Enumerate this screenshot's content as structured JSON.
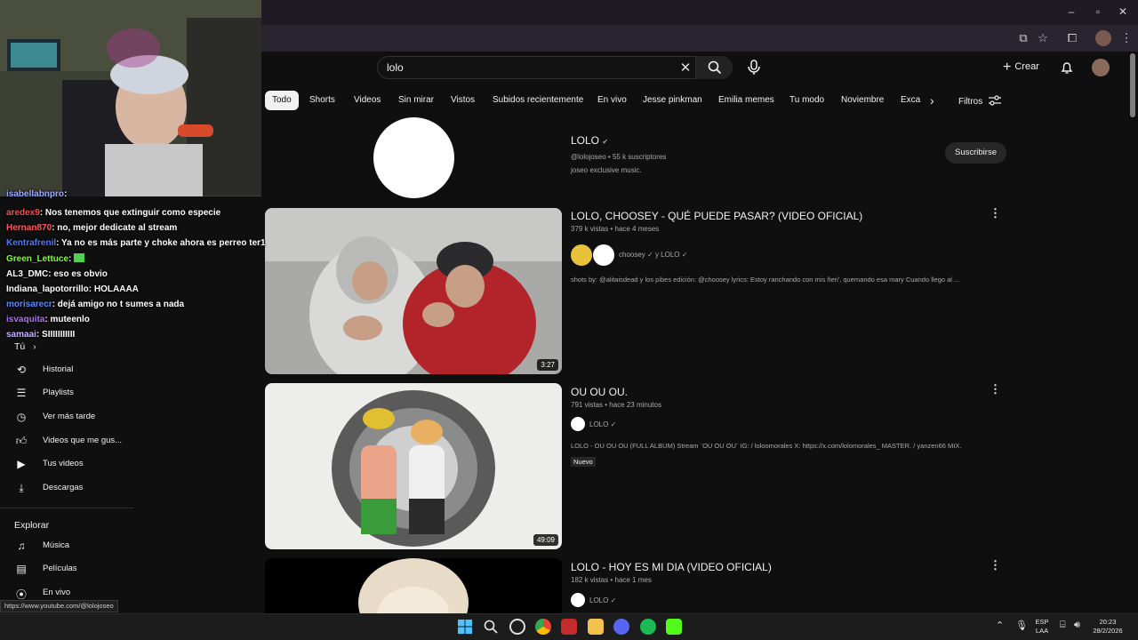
{
  "search": {
    "query": "lolo"
  },
  "header": {
    "create_label": "Crear"
  },
  "chips": [
    "Todo",
    "Shorts",
    "Videos",
    "Sin mirar",
    "Vistos",
    "Subidos recientemente",
    "En vivo",
    "Jesse pinkman",
    "Emilia memes",
    "Tu modo",
    "Noviembre",
    "Exca"
  ],
  "filters_label": "Filtros",
  "channel": {
    "name": "LOLO",
    "meta": "@lolojoseo • 55 k suscriptores",
    "description": "joseo exclusive music.",
    "subscribe_label": "Suscribirse"
  },
  "videos": [
    {
      "title": "LOLO, CHOOSEY - QUÉ PUEDE PASAR? (VIDEO OFICIAL)",
      "meta": "379 k vistas • hace 4 meses",
      "channel": "choosey ✓ y LOLO ✓",
      "description": "shots by: @alitaisdead y los pibes edición: @choosey lyrics: Estoy ranchando con mis ñeri', quemando esa mary Cuando llego al ...",
      "duration": "3:27"
    },
    {
      "title": "OU OU OU.",
      "meta": "791 vistas • hace 23 minutos",
      "channel": "LOLO ✓",
      "description": "LOLO - OU OU OU (FULL ALBUM) Stream ¨OU OU OU¨ IG: / loloomorales X: https://x.com/lolomorales_ MASTER. / yanzen66 MIX.",
      "badge": "Nuevo",
      "duration": "49:09"
    },
    {
      "title": "LOLO - HOY ES MI DIA (VIDEO OFICIAL)",
      "meta": "182 k vistas • hace 1 mes",
      "channel": "LOLO ✓"
    }
  ],
  "sidebar": {
    "you_label": "Tú",
    "you_items": [
      {
        "label": "Historial",
        "icon": "history-icon"
      },
      {
        "label": "Playlists",
        "icon": "playlists-icon"
      },
      {
        "label": "Ver más tarde",
        "icon": "watch-later-icon"
      },
      {
        "label": "Videos que me gus...",
        "icon": "like-icon"
      },
      {
        "label": "Tus videos",
        "icon": "your-videos-icon"
      },
      {
        "label": "Descargas",
        "icon": "download-icon"
      }
    ],
    "explore_label": "Explorar",
    "explore_items": [
      {
        "label": "Música",
        "icon": "music-icon"
      },
      {
        "label": "Películas",
        "icon": "movies-icon"
      },
      {
        "label": "En vivo",
        "icon": "live-icon"
      }
    ]
  },
  "chat": [
    {
      "user": "isabellabnpro",
      "text": ":",
      "color": "#9fa8ff"
    },
    {
      "user": "aredex9",
      "text": ": Nos tenemos que extinguir como especie",
      "color": "#ff4b4b"
    },
    {
      "user": "Hernan870",
      "text": ": no, mejor dedicate al stream",
      "color": "#ff5a5a"
    },
    {
      "user": "Kentrafrenil",
      "text": ": Ya no es más parte y choke ahora es perreo ter1",
      "color": "#4b7bff"
    },
    {
      "user": "Green_Lettuce",
      "text": ":",
      "color": "#7dff3a"
    },
    {
      "user": "AL3_DMC",
      "text": ": eso es obvio",
      "color": "#ffffff"
    },
    {
      "user": "Indiana_lapotorrillo",
      "text": ": HOLAAAA",
      "color": "#ffffff"
    },
    {
      "user": "morisarecr",
      "text": ": dejá amigo no t sumes a nada",
      "color": "#5a8cff"
    },
    {
      "user": "isvaquita",
      "text": ": muteenlo",
      "color": "#b46cff"
    },
    {
      "user": "samaai",
      "text": ": SIIIIIIIIIII",
      "color": "#ffffff"
    }
  ],
  "status_url": "https://www.youtube.com/@lolojoseo",
  "tray": {
    "lang_top": "ESP",
    "lang_bottom": "LAA",
    "time": "20:23",
    "date": "28/2/2026"
  }
}
